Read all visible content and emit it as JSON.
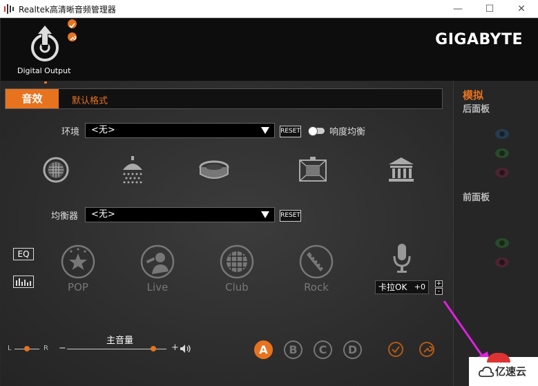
{
  "window": {
    "title": "Realtek高清晰音频管理器",
    "minimize": "—",
    "maximize": "☐",
    "close": "✕"
  },
  "device": {
    "label": "Digital Output"
  },
  "brand": "GIGABYTE",
  "tabs": [
    {
      "label": "音效",
      "active": true
    },
    {
      "label": "默认格式",
      "active": false
    }
  ],
  "environment": {
    "label": "环境",
    "value": "<无>",
    "reset": "RESET",
    "loudness_label": "响度均衡",
    "icons": [
      "manhole-icon",
      "shower-icon",
      "stadium-icon",
      "room-icon",
      "hall-icon"
    ]
  },
  "equalizer": {
    "label": "均衡器",
    "value": "<无>",
    "reset": "RESET",
    "eq_button": "EQ"
  },
  "genres": [
    "POP",
    "Live",
    "Club",
    "Rock"
  ],
  "karaoke": {
    "label": "卡拉OK",
    "value": "+0",
    "plus": "+",
    "minus": "-"
  },
  "volume": {
    "label": "主音量",
    "left": "L",
    "right": "R",
    "minus": "−",
    "plus": "+"
  },
  "profiles": [
    "A",
    "B",
    "C",
    "D"
  ],
  "right_panel": {
    "title": "模拟",
    "back_panel": "后面板",
    "front_panel": "前面板"
  },
  "watermark": "亿速云",
  "colors": {
    "accent": "#e8731f",
    "arrow": "#e020e0"
  }
}
